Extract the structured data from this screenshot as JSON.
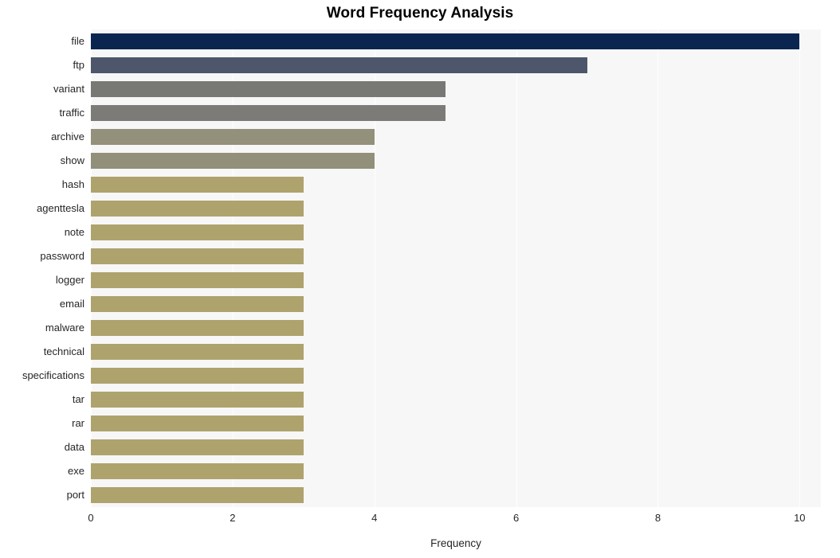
{
  "chart_data": {
    "type": "bar",
    "orientation": "horizontal",
    "title": "Word Frequency Analysis",
    "xlabel": "Frequency",
    "ylabel": "",
    "xlim": [
      0,
      10.3
    ],
    "xticks": [
      0,
      2,
      4,
      6,
      8,
      10
    ],
    "xtick_labels": [
      "0",
      "2",
      "4",
      "6",
      "8",
      "10"
    ],
    "grid": "vertical-white",
    "legend": "none",
    "categories": [
      "file",
      "ftp",
      "variant",
      "traffic",
      "archive",
      "show",
      "hash",
      "agenttesla",
      "note",
      "password",
      "logger",
      "email",
      "malware",
      "technical",
      "specifications",
      "tar",
      "rar",
      "data",
      "exe",
      "port"
    ],
    "values": [
      10,
      7,
      5,
      5,
      4,
      4,
      3,
      3,
      3,
      3,
      3,
      3,
      3,
      3,
      3,
      3,
      3,
      3,
      3,
      3
    ],
    "bar_colors": [
      "#0a2650",
      "#4d566b",
      "#787874",
      "#7c7b77",
      "#93907b",
      "#928f7a",
      "#aea36d",
      "#aea36d",
      "#aea36d",
      "#aea36d",
      "#aea36d",
      "#aea36d",
      "#aea36d",
      "#aea36d",
      "#aea36d",
      "#aea36d",
      "#aea36d",
      "#aea36d",
      "#aea36d",
      "#aea36d"
    ]
  },
  "style": {
    "plot_background": "#f7f7f7",
    "figure_background": "#ffffff",
    "gridline_color": "#ffffff",
    "tick_text_color": "#262626",
    "title_color": "#000000"
  }
}
